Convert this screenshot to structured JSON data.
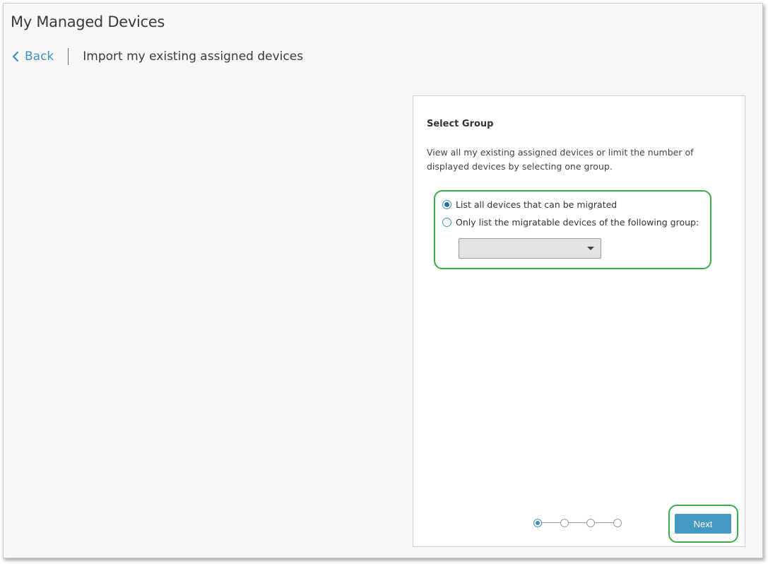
{
  "header": {
    "title": "My Managed Devices",
    "back_label": "Back",
    "subtitle": "Import my existing assigned devices"
  },
  "panel": {
    "heading": "Select Group",
    "description": "View all my existing assigned devices or limit the number of displayed devices by selecting one group.",
    "options": [
      {
        "label": "List all devices that can be migrated",
        "checked": true
      },
      {
        "label": "Only list the migratable devices of the following group:",
        "checked": false
      }
    ],
    "group_select": {
      "value": ""
    },
    "steps": {
      "total": 4,
      "current": 1
    },
    "next_label": "Next"
  },
  "colors": {
    "accent": "#3f8fbf",
    "button": "#4499c2",
    "highlight": "#3aae49",
    "background": "#f8f8f8"
  },
  "icons": {
    "back": "chevron-left-icon",
    "select": "caret-down-icon"
  }
}
